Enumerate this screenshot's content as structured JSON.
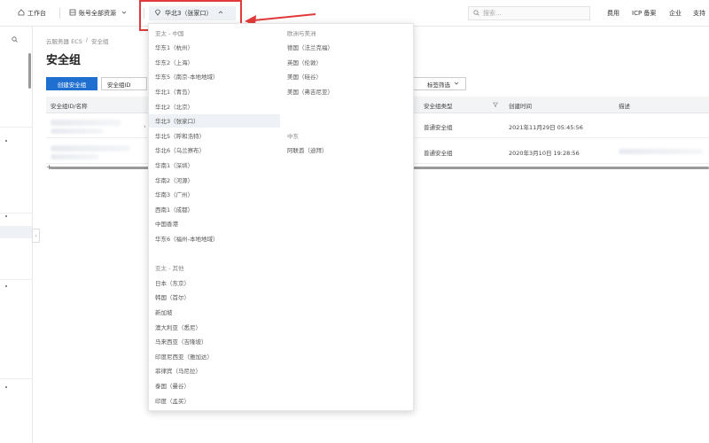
{
  "topbar": {
    "workbench_label": "工作台",
    "account_resource_label": "账号全部资源",
    "region_label": "华北3（张家口）",
    "search_placeholder": "搜索...",
    "links": [
      "费用",
      "ICP 备案",
      "企业",
      "支持"
    ]
  },
  "breadcrumb": [
    "云服务器 ECS",
    "/",
    "安全组"
  ],
  "page_title": "安全组",
  "toolbar": {
    "create_button": "创建安全组",
    "filter_select": "安全组ID",
    "tag_filter": "标签筛选"
  },
  "table": {
    "columns": [
      "安全组ID/名称",
      "安全组类型",
      "创建时间",
      "描述"
    ],
    "rows": [
      {
        "type": "普通安全组",
        "created": "2021年11月29日 05:45:56"
      },
      {
        "type": "普通安全组",
        "created": "2020年3月10日 19:28:56"
      }
    ]
  },
  "region_dropdown": {
    "left_column": [
      {
        "label": "亚太 - 中国",
        "group": true
      },
      {
        "label": "华东1（杭州）"
      },
      {
        "label": "华东2（上海）"
      },
      {
        "label": "华东5（南京-本地地域）"
      },
      {
        "label": "华北1（青岛）"
      },
      {
        "label": "华北2（北京）"
      },
      {
        "label": "华北3（张家口）",
        "selected": true
      },
      {
        "label": "华北5（呼和浩特）"
      },
      {
        "label": "华北6（乌兰察布）"
      },
      {
        "label": "华南1（深圳）"
      },
      {
        "label": "华南2（河源）"
      },
      {
        "label": "华南3（广州）"
      },
      {
        "label": "西南1（成都）"
      },
      {
        "label": "中国香港"
      },
      {
        "label": "华东6（福州-本地地域）"
      },
      {
        "label": "",
        "spacer": true
      },
      {
        "label": "亚太 - 其他",
        "group": true
      },
      {
        "label": "日本（东京）"
      },
      {
        "label": "韩国（首尔）"
      },
      {
        "label": "新加坡"
      },
      {
        "label": "澳大利亚（悉尼）"
      },
      {
        "label": "马来西亚（吉隆坡）"
      },
      {
        "label": "印度尼西亚（雅加达）"
      },
      {
        "label": "菲律宾（马尼拉）"
      },
      {
        "label": "泰国（曼谷）"
      },
      {
        "label": "印度（孟买）"
      }
    ],
    "right_column": [
      {
        "label": "欧洲与美洲",
        "group": true
      },
      {
        "label": "德国（法兰克福）"
      },
      {
        "label": "英国（伦敦）"
      },
      {
        "label": "美国（硅谷）"
      },
      {
        "label": "美国（弗吉尼亚）"
      },
      {
        "label": "",
        "spacer": true
      },
      {
        "label": "",
        "spacer": true
      },
      {
        "label": "中东",
        "group": true
      },
      {
        "label": "阿联酋（迪拜）"
      }
    ]
  },
  "colors": {
    "primary": "#1f6fd1",
    "highlight": "#e23a3a"
  }
}
